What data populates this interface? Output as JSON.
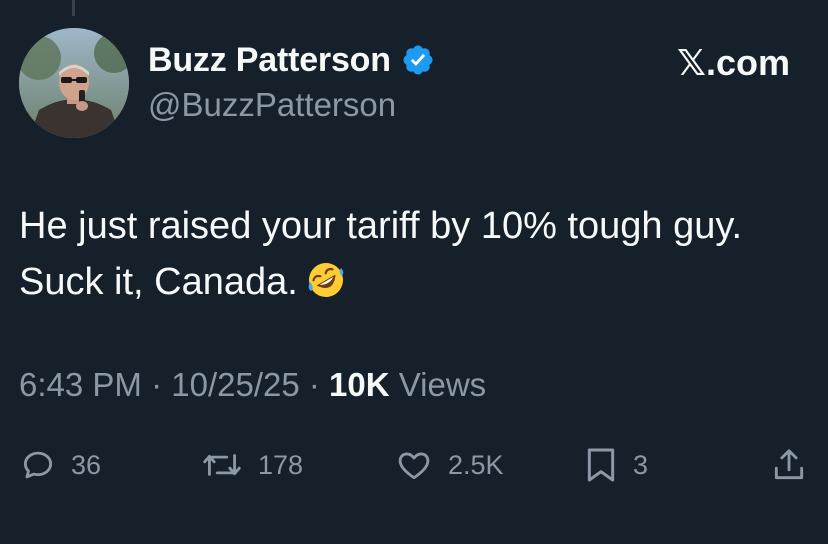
{
  "author": {
    "display_name": "Buzz Patterson",
    "handle": "@BuzzPatterson",
    "verified_icon": "verified-badge-icon"
  },
  "brand": "𝕏.com",
  "tweet": {
    "text": "He just raised your tariff by 10% tough guy. Suck it, Canada.",
    "emoji": "rolling-on-floor-laughing-emoji"
  },
  "meta": {
    "time": "6:43 PM",
    "separator": " · ",
    "date": "10/25/25",
    "views_count": "10K",
    "views_label": "Views"
  },
  "actions": {
    "replies": "36",
    "reposts": "178",
    "likes": "2.5K",
    "bookmarks": "3"
  },
  "colors": {
    "background": "#15202b",
    "text": "#f7f9f9",
    "secondary": "#8b98a5",
    "verified": "#1d9bf0"
  }
}
